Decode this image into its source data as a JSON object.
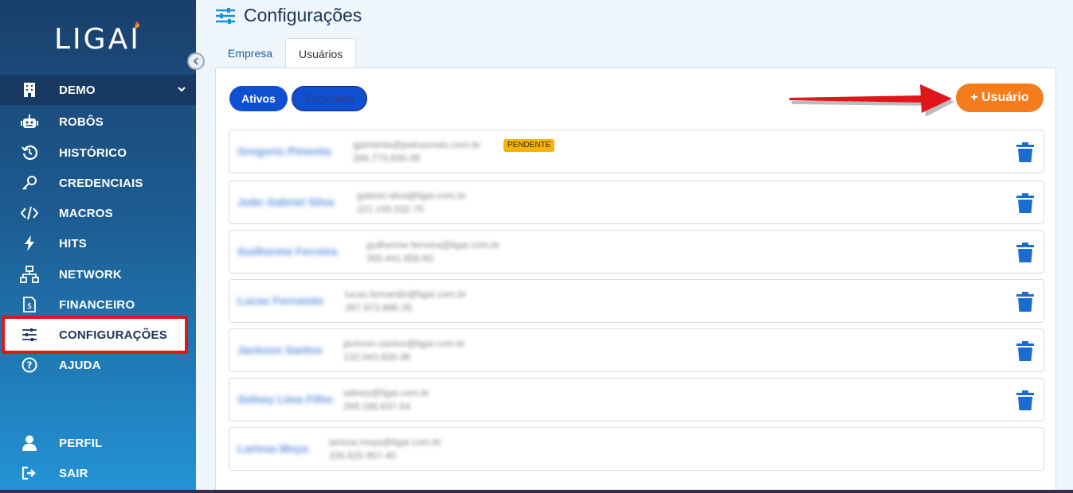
{
  "app": {
    "logo_text": "LIGAI"
  },
  "sidebar": {
    "org": "DEMO",
    "items": [
      {
        "label": "ROBÔS",
        "icon": "robot-icon"
      },
      {
        "label": "HISTÓRICO",
        "icon": "history-icon"
      },
      {
        "label": "CREDENCIAIS",
        "icon": "key-icon"
      },
      {
        "label": "MACROS",
        "icon": "code-icon"
      },
      {
        "label": "HITS",
        "icon": "bolt-icon"
      },
      {
        "label": "NETWORK",
        "icon": "network-icon"
      },
      {
        "label": "FINANCEIRO",
        "icon": "invoice-icon"
      },
      {
        "label": "CONFIGURAÇÕES",
        "icon": "sliders-icon",
        "active": true
      },
      {
        "label": "AJUDA",
        "icon": "help-icon"
      }
    ],
    "bottom": [
      {
        "label": "PERFIL",
        "icon": "user-icon"
      },
      {
        "label": "SAIR",
        "icon": "logout-icon"
      }
    ]
  },
  "header": {
    "title": "Configurações"
  },
  "tabs": [
    {
      "label": "Empresa",
      "active": false
    },
    {
      "label": "Usuários",
      "active": true
    }
  ],
  "filters": {
    "active_label": "Ativos",
    "deleted_label": "Excluídos"
  },
  "add_user_label": "+ Usuário",
  "users": [
    {
      "name": "Gregorio Pimenta",
      "email": "gpimenta@petrusmais.com.br",
      "phone": "286.773.830-39",
      "badge": "PENDENTE"
    },
    {
      "name": "João Gabriel Silva",
      "email": "gabriel.silva@ligai.com.br",
      "phone": "221.145.532-75",
      "badge": ""
    },
    {
      "name": "Guilherme Ferreira",
      "email": "guilherme.ferreira@ligai.com.br",
      "phone": "355.441.958-60",
      "badge": ""
    },
    {
      "name": "Lucas Fernando",
      "email": "lucas.fernando@ligai.com.br",
      "phone": "387.973.886-35",
      "badge": ""
    },
    {
      "name": "Jackson Santos",
      "email": "jackson.santos@ligai.com.br",
      "phone": "132.043.826-36",
      "badge": ""
    },
    {
      "name": "Sidney Lima Filho",
      "email": "sidney@ligai.com.br",
      "phone": "289.186.637-54",
      "badge": ""
    },
    {
      "name": "Larissa Moya",
      "email": "larissa.moya@ligai.com.br",
      "phone": "335.625.957-40",
      "badge": ""
    }
  ],
  "colors": {
    "accent": "#0f4fd1",
    "add_button": "#f57c1a",
    "delete_icon": "#1b6ccf",
    "highlight": "#e0161b"
  }
}
